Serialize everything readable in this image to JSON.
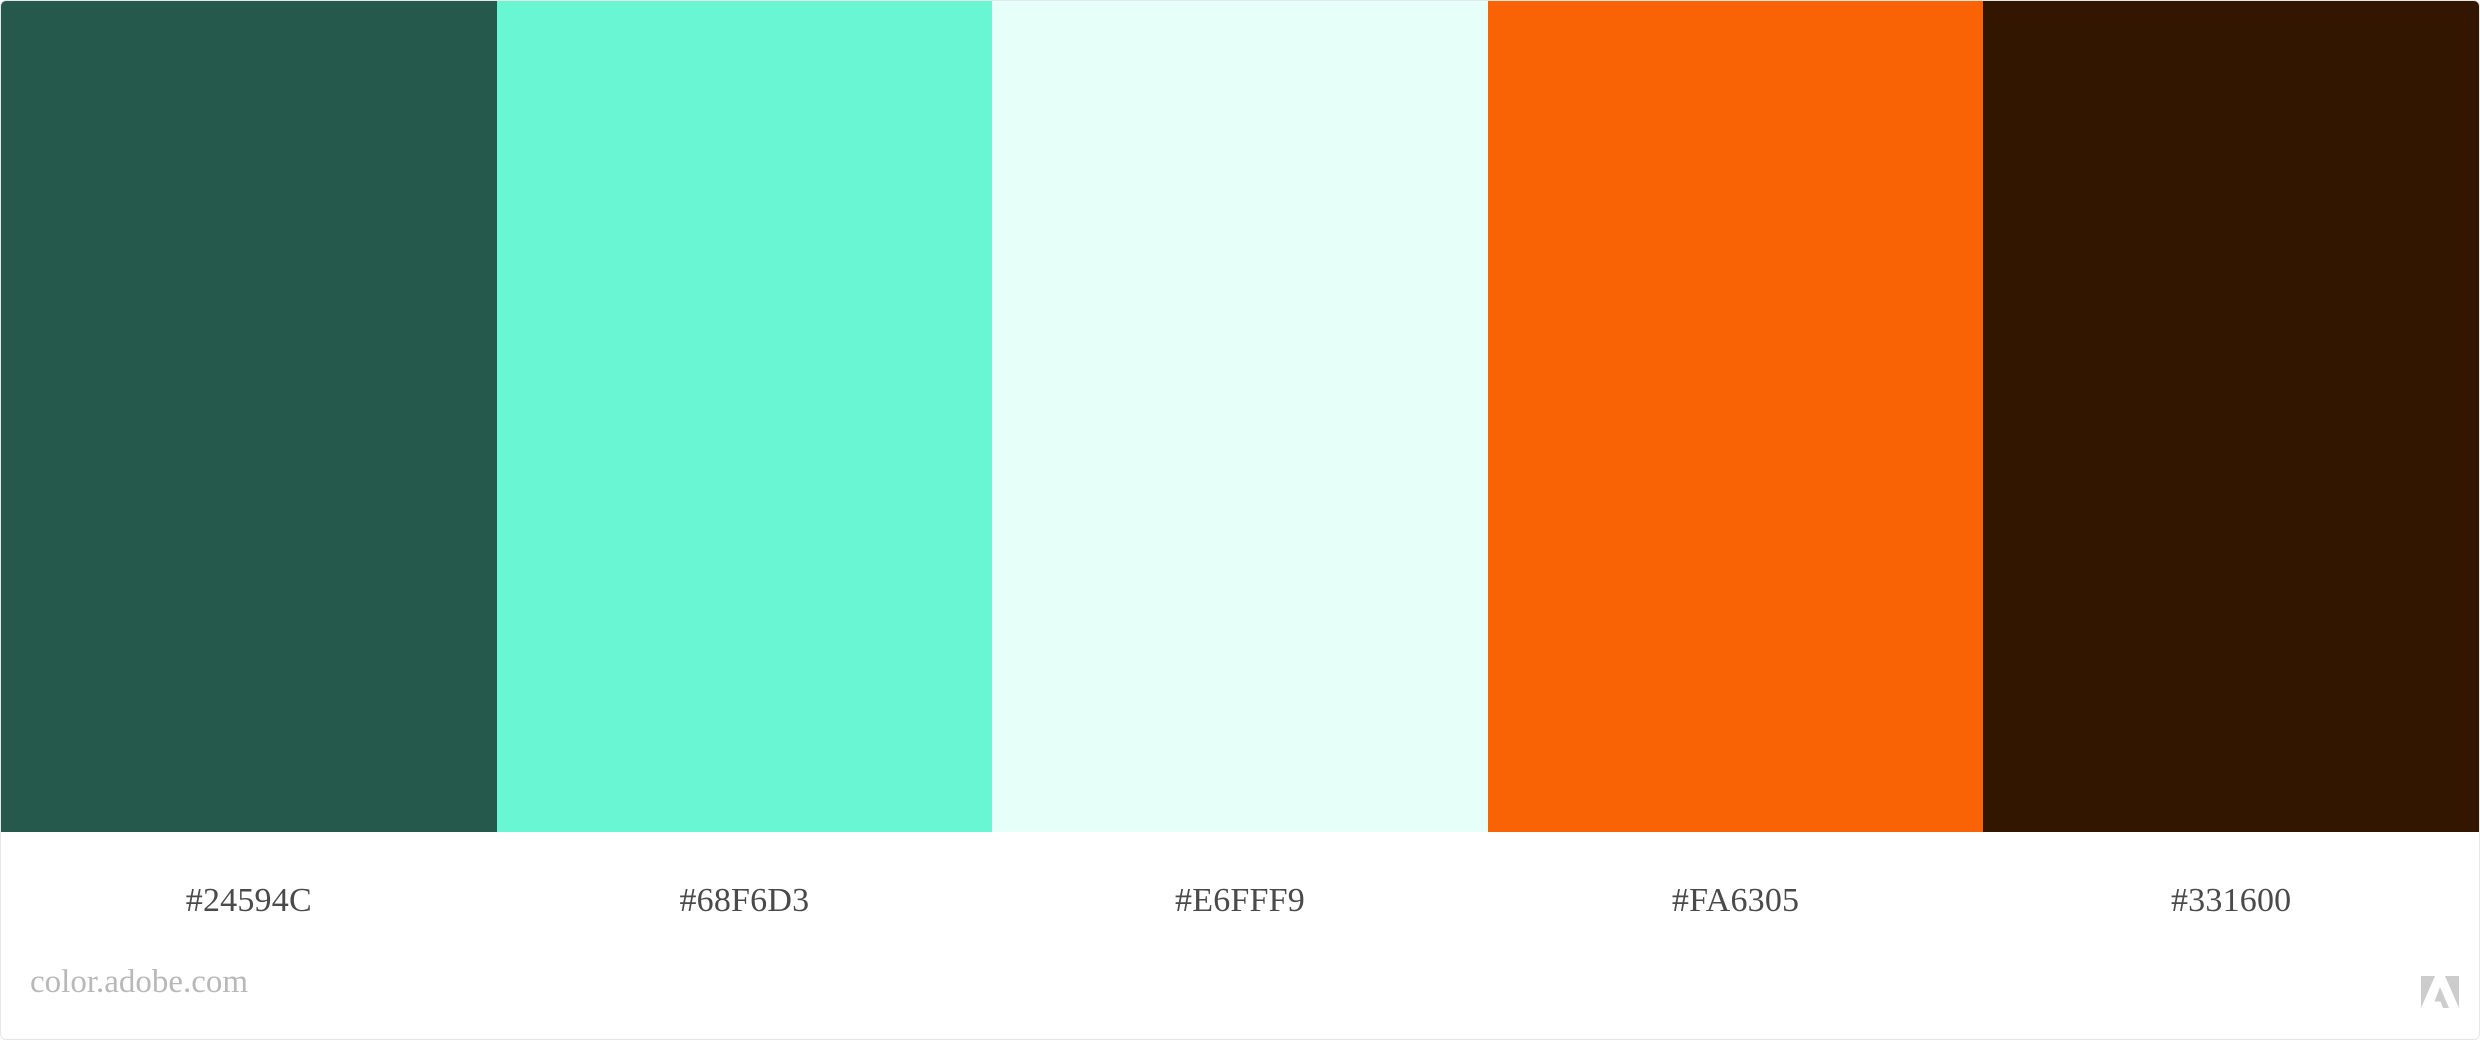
{
  "palette": {
    "swatches": [
      {
        "hex": "#24594C",
        "label": "#24594C"
      },
      {
        "hex": "#68F6D3",
        "label": "#68F6D3"
      },
      {
        "hex": "#E6FFF9",
        "label": "#E6FFF9"
      },
      {
        "hex": "#FA6305",
        "label": "#FA6305"
      },
      {
        "hex": "#331600",
        "label": "#331600"
      }
    ]
  },
  "footer": {
    "brand_text": "color.adobe.com",
    "logo_icon": "adobe-logo-icon",
    "logo_color": "#cccccc"
  }
}
